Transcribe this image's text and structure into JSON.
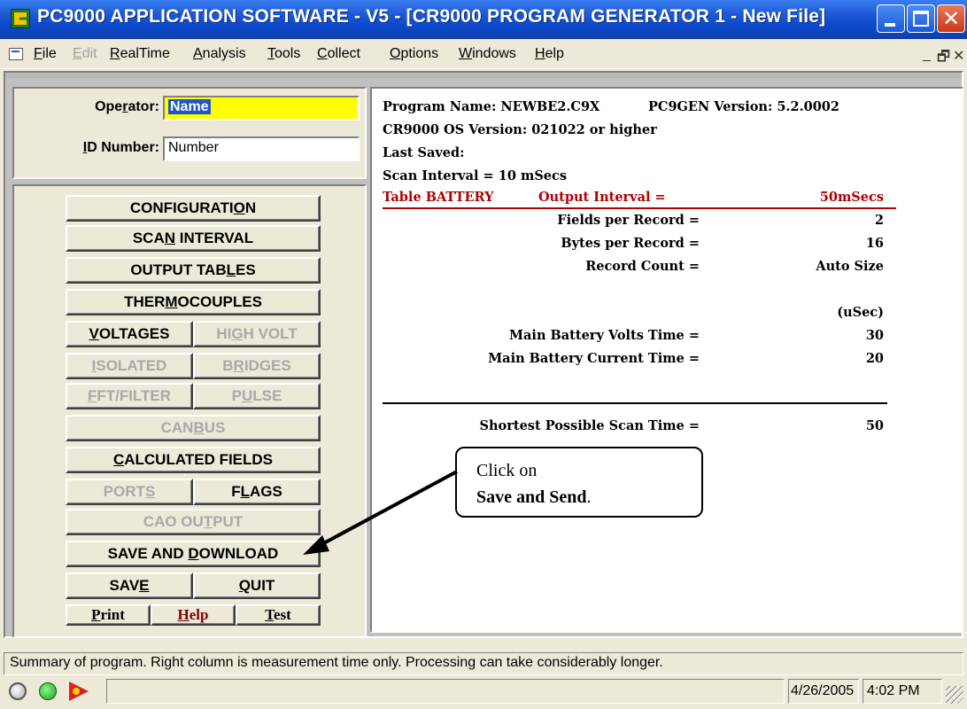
{
  "window": {
    "title": "PC9000 APPLICATION SOFTWARE - V5 - [CR9000 PROGRAM GENERATOR 1   - New File]",
    "minimize": "",
    "maximize": "",
    "close": "✕"
  },
  "menu": {
    "items": [
      {
        "label": "File",
        "accel": "F",
        "rest": "ile",
        "enabled": true
      },
      {
        "label": "Edit",
        "accel": "E",
        "rest": "dit",
        "enabled": false
      },
      {
        "label": "RealTime",
        "accel": "R",
        "rest": "ealTime",
        "enabled": true
      },
      {
        "label": "Analysis",
        "accel": "A",
        "rest": "nalysis",
        "enabled": true
      },
      {
        "label": "Tools",
        "accel": "T",
        "rest": "ools",
        "enabled": true
      },
      {
        "label": "Collect",
        "accel": "C",
        "rest": "ollect",
        "enabled": true
      },
      {
        "label": "Options",
        "accel": "O",
        "rest": "ptions",
        "enabled": true
      },
      {
        "label": "Windows",
        "accel": "W",
        "rest": "indows",
        "enabled": true
      },
      {
        "label": "Help",
        "accel": "H",
        "rest": "elp",
        "enabled": true
      }
    ],
    "mdi_min": "_",
    "mdi_restore": "🗗",
    "mdi_close": "✕"
  },
  "operator": {
    "operator_label_a": "Ope",
    "operator_label_accel": "r",
    "operator_label_b": "ator:",
    "operator_value": "Name",
    "id_label_accel": "I",
    "id_label_rest": "D Number:",
    "id_value": "Number"
  },
  "buttons": {
    "configuration": {
      "pre": "CONFIGURATI",
      "accel": "O",
      "post": "N",
      "enabled": true
    },
    "scan_interval": {
      "pre": "SCA",
      "accel": "N",
      "post": " INTERVAL",
      "enabled": true
    },
    "output_tables": {
      "pre": "OUTPUT TAB",
      "accel": "L",
      "post": "ES",
      "enabled": true
    },
    "thermocouples": {
      "pre": "THER",
      "accel": "M",
      "post": "OCOUPLES",
      "enabled": true
    },
    "voltages": {
      "pre": "",
      "accel": "V",
      "post": "OLTAGES",
      "enabled": true
    },
    "high_volt": {
      "pre": "HI",
      "accel": "G",
      "post": "H VOLT",
      "enabled": false
    },
    "isolated": {
      "pre": "",
      "accel": "I",
      "post": "SOLATED",
      "enabled": false
    },
    "bridges": {
      "pre": "B",
      "accel": "R",
      "post": "IDGES",
      "enabled": false
    },
    "fft_filter": {
      "pre": "",
      "accel": "F",
      "post": "FT/FILTER",
      "enabled": false
    },
    "pulse": {
      "pre": "P",
      "accel": "U",
      "post": "LSE",
      "enabled": false
    },
    "canbus": {
      "pre": "CAN",
      "accel": "B",
      "post": "US",
      "enabled": false
    },
    "calculated_fields": {
      "pre": "",
      "accel": "C",
      "post": "ALCULATED FIELDS",
      "enabled": true
    },
    "ports": {
      "pre": "PORT",
      "accel": "S",
      "post": "",
      "enabled": false
    },
    "flags": {
      "pre": "F",
      "accel": "L",
      "post": "AGS",
      "enabled": true
    },
    "cao_output": {
      "pre": "CAO OU",
      "accel": "T",
      "post": "PUT",
      "enabled": false
    },
    "save_and_download": {
      "pre": "SAVE AND ",
      "accel": "D",
      "post": "OWNLOAD",
      "enabled": true
    },
    "save": {
      "pre": "SAV",
      "accel": "E",
      "post": "",
      "enabled": true
    },
    "quit": {
      "pre": "",
      "accel": "Q",
      "post": "UIT",
      "enabled": true
    },
    "print": {
      "pre": "",
      "accel": "P",
      "post": "rint",
      "enabled": true
    },
    "help": {
      "pre": "",
      "accel": "H",
      "post": "elp",
      "enabled": true
    },
    "test": {
      "pre": "",
      "accel": "T",
      "post": "est",
      "enabled": true
    }
  },
  "summary": {
    "program_name": "Program Name: NEWBE2.C9X",
    "pc9gen_version": "PC9GEN Version: 5.2.0002",
    "os_version": "CR9000 OS Version: 021022 or higher",
    "last_saved": "Last Saved:",
    "scan_interval": "Scan Interval = 10 mSecs",
    "table_label": "Table BATTERY",
    "output_interval_label": "Output Interval =",
    "output_interval_value": "50mSecs",
    "fields_label": "Fields per Record =",
    "fields_value": "2",
    "bytes_label": "Bytes per Record =",
    "bytes_value": "16",
    "record_count_label": "Record Count =",
    "record_count_value": "Auto Size",
    "units": "(uSec)",
    "mbv_label": "Main Battery Volts Time =",
    "mbv_value": "30",
    "mbc_label": "Main Battery Current Time =",
    "mbc_value": "20",
    "shortest_label": "Shortest Possible Scan Time =",
    "shortest_value": "50"
  },
  "callout": {
    "line1": "Click on",
    "line2_bold": "Save and Send",
    "line2_tail": "."
  },
  "status": {
    "message": "Summary of program. Right column is measurement time only. Processing can take considerably longer.",
    "date": "4/26/2005",
    "time": "4:02 PM"
  },
  "icons": {
    "app": "app-icon",
    "led_idle": "led-gray-icon",
    "led_connected": "led-green-icon",
    "run": "run-arrow-icon"
  }
}
